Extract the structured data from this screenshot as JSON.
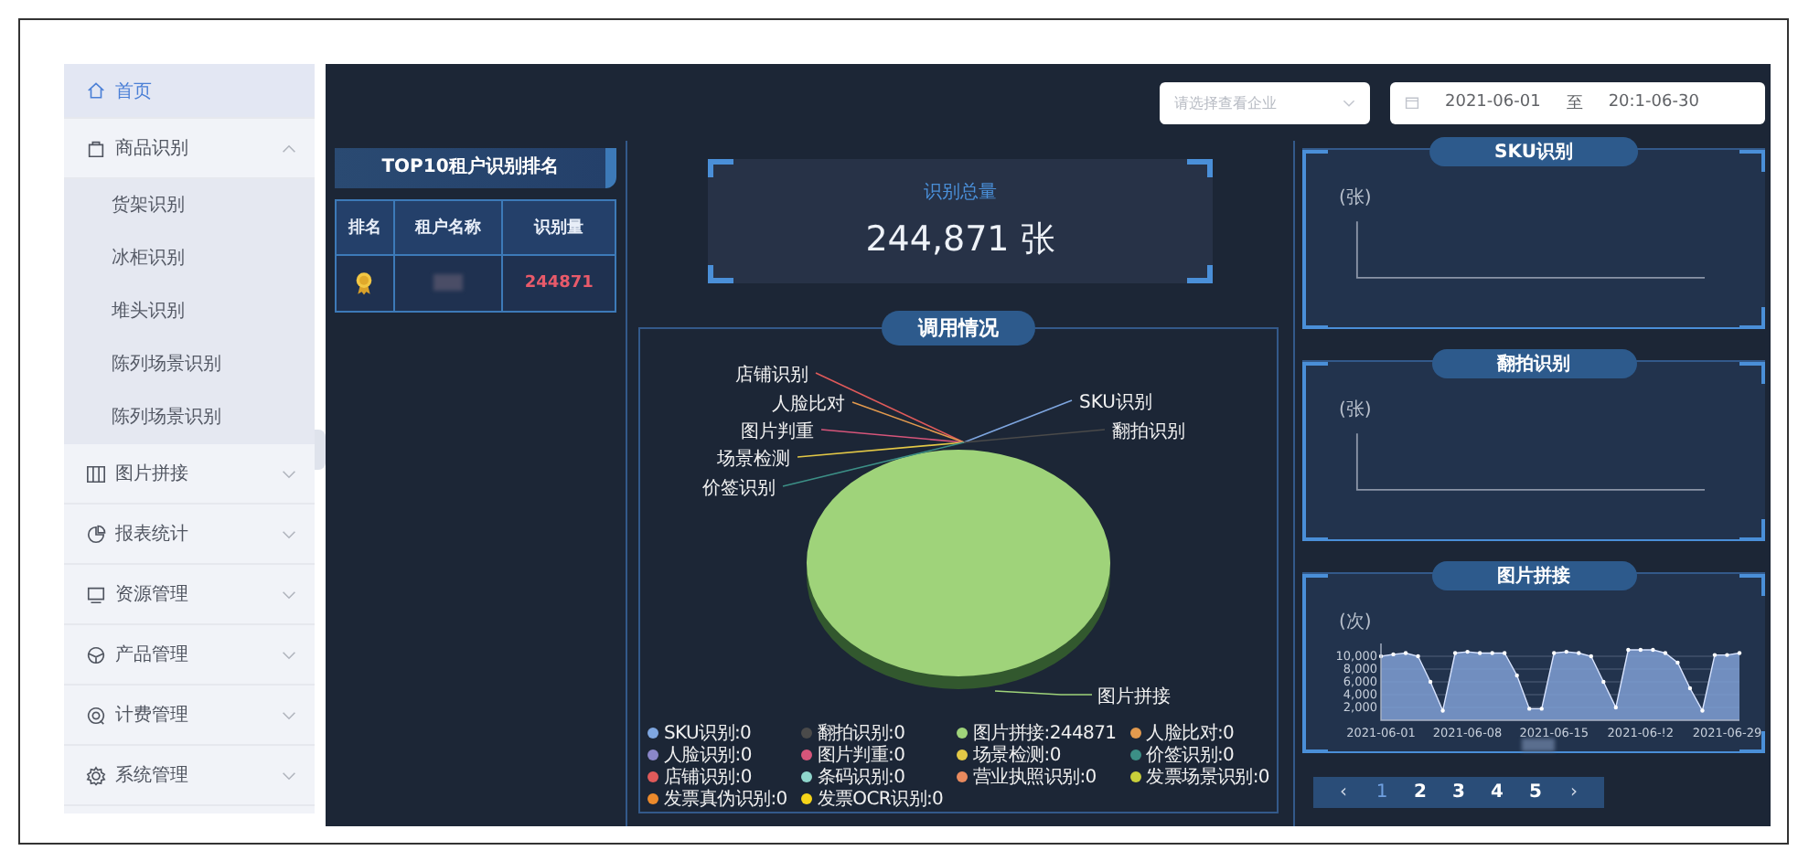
{
  "sidebar": {
    "items": [
      {
        "kind": "link",
        "label": "首页",
        "selected": true
      },
      {
        "kind": "group",
        "label": "商品识别",
        "selected": false,
        "expanded": true,
        "children": [
          {
            "label": "货架识别",
            "selected": false
          },
          {
            "label": "冰柜识别",
            "selected": false
          },
          {
            "label": "堆头识别",
            "selected": false
          },
          {
            "label": "陈列场景识别",
            "selected": false
          },
          {
            "label": "陈列场景识别",
            "selected": false
          }
        ]
      },
      {
        "kind": "group",
        "label": "图片拼接",
        "selected": false,
        "expanded": false
      },
      {
        "kind": "group",
        "label": "报表统计",
        "selected": false,
        "expanded": false
      },
      {
        "kind": "group",
        "label": "资源管理",
        "selected": false,
        "expanded": false
      },
      {
        "kind": "group",
        "label": "产品管理",
        "selected": false,
        "expanded": false
      },
      {
        "kind": "group",
        "label": "计费管理",
        "selected": false,
        "expanded": false
      },
      {
        "kind": "group",
        "label": "系统管理",
        "selected": false,
        "expanded": false
      }
    ]
  },
  "filters": {
    "company_select": {
      "placeholder": "请选择查看企业"
    },
    "date_range": {
      "start": "2021-06-01",
      "separator": "至",
      "end": "20:1-06-30"
    }
  },
  "ranking": {
    "title": "TOP10租户识别排名",
    "columns": [
      "排名",
      "租户名称",
      "识别量"
    ],
    "rows": [
      {
        "count": "244871"
      }
    ]
  },
  "total": {
    "label": "识别总量",
    "value": "244,871 张"
  },
  "usage": {
    "title": "调用情况",
    "slice_labels": [
      {
        "text": "店铺识别",
        "color": "#e05a5a"
      },
      {
        "text": "人脸比对",
        "color": "#e39a4e"
      },
      {
        "text": "图片判重",
        "color": "#d6557a"
      },
      {
        "text": "场景检测",
        "color": "#e3c846"
      },
      {
        "text": "价签识别",
        "color": "#3c8f86"
      },
      {
        "text": "SKU识别",
        "color": "#7ea6e0"
      },
      {
        "text": "翻拍识别",
        "color": "#4a4a4a"
      },
      {
        "text": "图片拼接",
        "color": "#9fd37a"
      }
    ],
    "chart_data": {
      "type": "pie",
      "categories": [
        "SKU识别:0",
        "翻拍识别:0",
        "图片拼接:244871",
        "人脸比对:0",
        "人脸识别:0",
        "图片判重:0",
        "场景检测:0",
        "价签识别:0",
        "店铺识别:0",
        "条码识别:0",
        "营业执照识别:0",
        "发票场景识别:0",
        "发票真伪识别:0",
        "发票OCR识别:0"
      ],
      "values": [
        0,
        0,
        244871,
        0,
        0,
        0,
        0,
        0,
        0,
        0,
        0,
        0,
        0,
        0
      ],
      "colors": [
        "#7ea6e0",
        "#4a4a4a",
        "#9fd37a",
        "#e39a4e",
        "#8a86c9",
        "#d6557a",
        "#e3c846",
        "#3c8f86",
        "#e05a5a",
        "#8fd6cc",
        "#e98a5e",
        "#c9cf3a",
        "#ec8a2c",
        "#f5d419"
      ]
    }
  },
  "side_charts": [
    {
      "kind": "empty",
      "title": "SKU识别",
      "unit": "(张)"
    },
    {
      "kind": "empty",
      "title": "翻拍识别",
      "unit": "(张)"
    },
    {
      "kind": "area",
      "title": "图片拼接",
      "chart_data": {
        "type": "area",
        "ylabel": "(次)",
        "categories": [
          "2021-06-01",
          null,
          null,
          null,
          null,
          null,
          null,
          "2021-06-08",
          null,
          null,
          null,
          null,
          null,
          null,
          "2021-06-15",
          null,
          null,
          null,
          null,
          null,
          null,
          "2021-06-!2",
          null,
          null,
          null,
          null,
          null,
          null,
          "2021-06-29",
          null
        ],
        "values": [
          10000,
          10300,
          10500,
          10000,
          6000,
          1500,
          10500,
          10700,
          10500,
          10500,
          10500,
          7000,
          1800,
          1800,
          10500,
          10700,
          10500,
          10000,
          6000,
          2000,
          11000,
          11000,
          11000,
          10500,
          9000,
          5000,
          1500,
          10200,
          10200,
          10500
        ],
        "ylim": [
          0,
          12000
        ],
        "grid": true,
        "yticks": [
          {
            "value": 2000,
            "label": "2,000"
          },
          {
            "value": 4000,
            "label": "4,000"
          },
          {
            "value": 6000,
            "label": "6,000"
          },
          {
            "value": 8000,
            "label": "8,000"
          },
          {
            "value": 10000,
            "label": "10,000"
          }
        ]
      }
    }
  ],
  "pagination": {
    "prev": "‹",
    "next": "›",
    "pages": [
      {
        "label": "1",
        "selected": true
      },
      {
        "label": "2",
        "selected": false
      },
      {
        "label": "3",
        "selected": false
      },
      {
        "label": "4",
        "selected": false
      },
      {
        "label": "5",
        "selected": false
      }
    ]
  }
}
